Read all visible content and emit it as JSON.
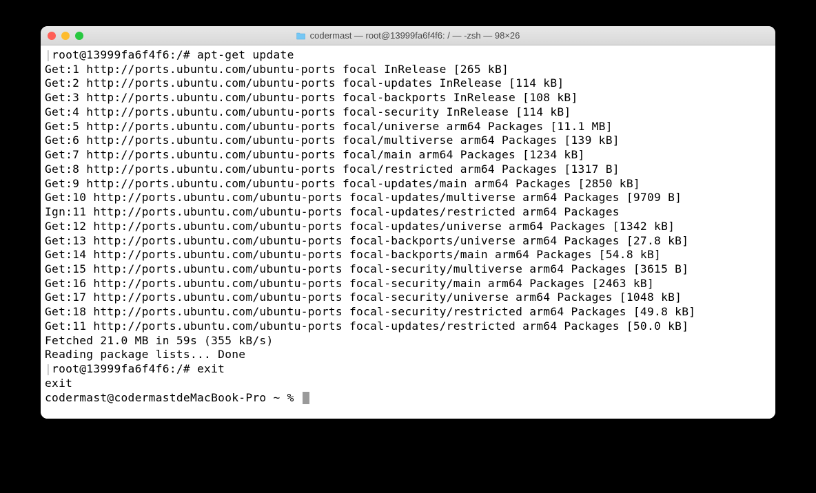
{
  "window": {
    "title": "codermast — root@13999fa6f4f6: / — -zsh — 98×26"
  },
  "terminal": {
    "lines": [
      {
        "caret": true,
        "text": "root@13999fa6f4f6:/# apt-get update"
      },
      {
        "caret": false,
        "text": "Get:1 http://ports.ubuntu.com/ubuntu-ports focal InRelease [265 kB]"
      },
      {
        "caret": false,
        "text": "Get:2 http://ports.ubuntu.com/ubuntu-ports focal-updates InRelease [114 kB]"
      },
      {
        "caret": false,
        "text": "Get:3 http://ports.ubuntu.com/ubuntu-ports focal-backports InRelease [108 kB]"
      },
      {
        "caret": false,
        "text": "Get:4 http://ports.ubuntu.com/ubuntu-ports focal-security InRelease [114 kB]"
      },
      {
        "caret": false,
        "text": "Get:5 http://ports.ubuntu.com/ubuntu-ports focal/universe arm64 Packages [11.1 MB]"
      },
      {
        "caret": false,
        "text": "Get:6 http://ports.ubuntu.com/ubuntu-ports focal/multiverse arm64 Packages [139 kB]"
      },
      {
        "caret": false,
        "text": "Get:7 http://ports.ubuntu.com/ubuntu-ports focal/main arm64 Packages [1234 kB]"
      },
      {
        "caret": false,
        "text": "Get:8 http://ports.ubuntu.com/ubuntu-ports focal/restricted arm64 Packages [1317 B]"
      },
      {
        "caret": false,
        "text": "Get:9 http://ports.ubuntu.com/ubuntu-ports focal-updates/main arm64 Packages [2850 kB]"
      },
      {
        "caret": false,
        "text": "Get:10 http://ports.ubuntu.com/ubuntu-ports focal-updates/multiverse arm64 Packages [9709 B]"
      },
      {
        "caret": false,
        "text": "Ign:11 http://ports.ubuntu.com/ubuntu-ports focal-updates/restricted arm64 Packages"
      },
      {
        "caret": false,
        "text": "Get:12 http://ports.ubuntu.com/ubuntu-ports focal-updates/universe arm64 Packages [1342 kB]"
      },
      {
        "caret": false,
        "text": "Get:13 http://ports.ubuntu.com/ubuntu-ports focal-backports/universe arm64 Packages [27.8 kB]"
      },
      {
        "caret": false,
        "text": "Get:14 http://ports.ubuntu.com/ubuntu-ports focal-backports/main arm64 Packages [54.8 kB]"
      },
      {
        "caret": false,
        "text": "Get:15 http://ports.ubuntu.com/ubuntu-ports focal-security/multiverse arm64 Packages [3615 B]"
      },
      {
        "caret": false,
        "text": "Get:16 http://ports.ubuntu.com/ubuntu-ports focal-security/main arm64 Packages [2463 kB]"
      },
      {
        "caret": false,
        "text": "Get:17 http://ports.ubuntu.com/ubuntu-ports focal-security/universe arm64 Packages [1048 kB]"
      },
      {
        "caret": false,
        "text": "Get:18 http://ports.ubuntu.com/ubuntu-ports focal-security/restricted arm64 Packages [49.8 kB]"
      },
      {
        "caret": false,
        "text": "Get:11 http://ports.ubuntu.com/ubuntu-ports focal-updates/restricted arm64 Packages [50.0 kB]"
      },
      {
        "caret": false,
        "text": "Fetched 21.0 MB in 59s (355 kB/s)"
      },
      {
        "caret": false,
        "text": "Reading package lists... Done"
      },
      {
        "caret": true,
        "text": "root@13999fa6f4f6:/# exit"
      },
      {
        "caret": false,
        "text": "exit"
      },
      {
        "caret": false,
        "text": "codermast@codermastdeMacBook-Pro ~ % ",
        "cursor": true
      }
    ]
  }
}
